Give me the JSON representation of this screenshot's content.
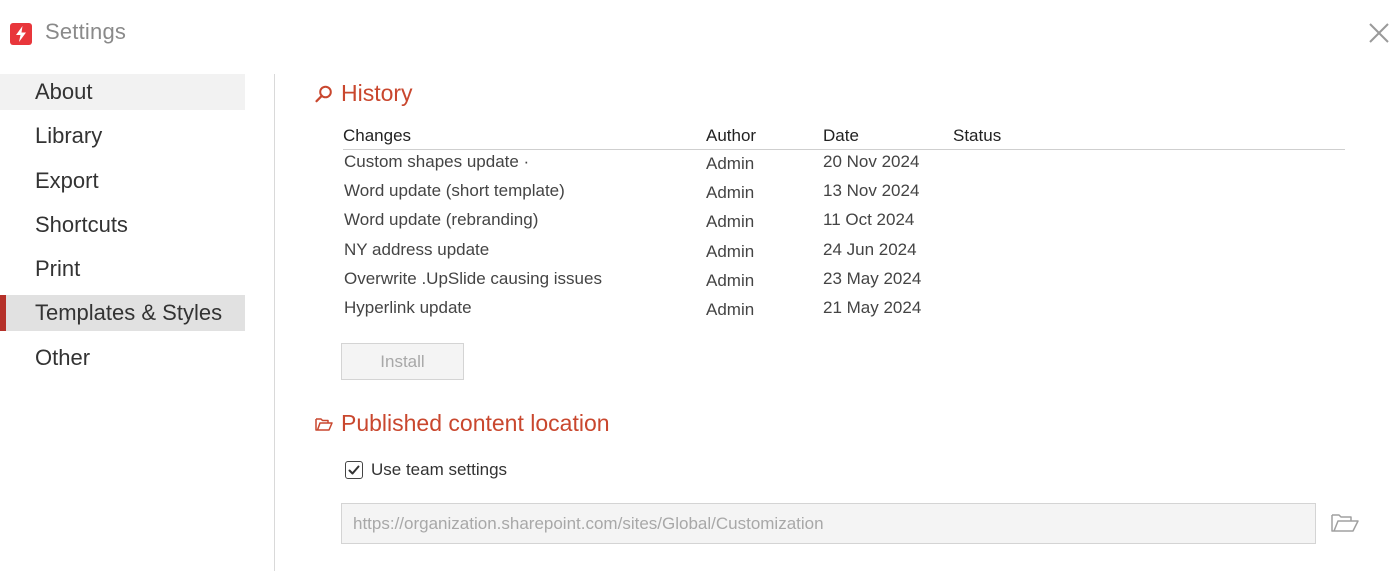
{
  "window": {
    "title": "Settings",
    "logo_icon": "upslide-logo-icon",
    "close_icon": "close-icon"
  },
  "sidebar": {
    "items": [
      {
        "label": "About",
        "state": "hover"
      },
      {
        "label": "Library",
        "state": "normal"
      },
      {
        "label": "Export",
        "state": "normal"
      },
      {
        "label": "Shortcuts",
        "state": "normal"
      },
      {
        "label": "Print",
        "state": "normal"
      },
      {
        "label": "Templates & Styles",
        "state": "active"
      },
      {
        "label": "Other",
        "state": "normal"
      }
    ]
  },
  "history": {
    "title": "History",
    "icon": "search-icon",
    "columns": {
      "changes": "Changes",
      "author": "Author",
      "date": "Date",
      "status": "Status"
    },
    "rows": [
      {
        "changes": "Custom shapes update ·",
        "author": "Admin",
        "date": "20 Nov 2024",
        "status": ""
      },
      {
        "changes": "Word update (short template)",
        "author": "Admin",
        "date": "13 Nov 2024",
        "status": ""
      },
      {
        "changes": "Word update (rebranding)",
        "author": "Admin",
        "date": "11 Oct 2024",
        "status": ""
      },
      {
        "changes": "NY address update",
        "author": "Admin",
        "date": "24 Jun 2024",
        "status": ""
      },
      {
        "changes": "Overwrite .UpSlide causing issues",
        "author": "Admin",
        "date": "23 May 2024",
        "status": ""
      },
      {
        "changes": "Hyperlink update",
        "author": "Admin",
        "date": "21 May 2024",
        "status": ""
      }
    ],
    "install_label": "Install"
  },
  "published": {
    "title": "Published content location",
    "icon": "folder-open-icon",
    "use_team_settings_label": "Use team settings",
    "use_team_settings_checked": true,
    "path_value": "https://organization.sharepoint.com/sites/Global/Customization",
    "browse_icon": "folder-open-icon"
  },
  "colors": {
    "accent": "#c9472e",
    "active_marker": "#b5312a",
    "logo": "#e8363b"
  }
}
